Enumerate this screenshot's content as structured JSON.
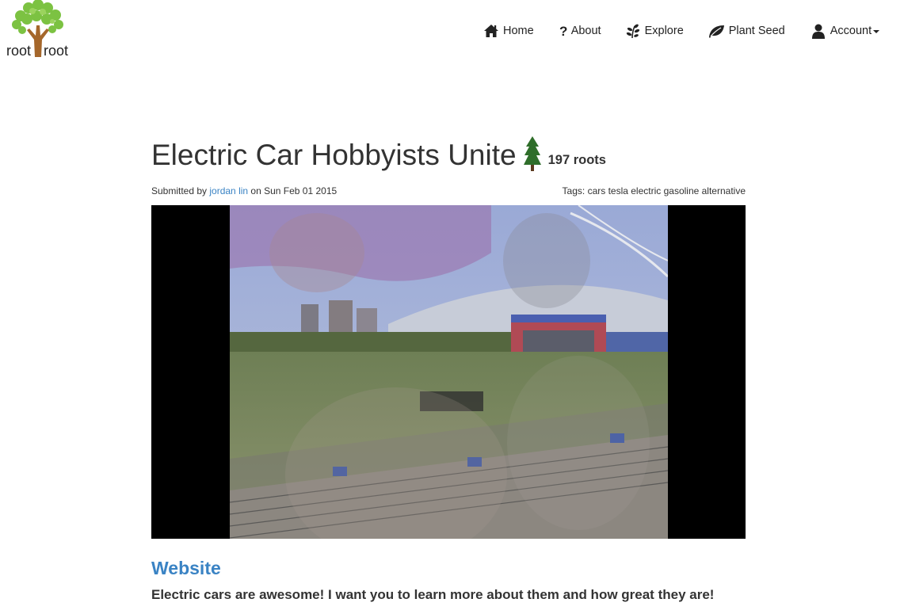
{
  "logo": {
    "word_left": "root",
    "word_right": "root"
  },
  "nav": {
    "items": [
      {
        "label": "Home",
        "icon": "home-icon"
      },
      {
        "label": "About",
        "icon": "question-icon"
      },
      {
        "label": "Explore",
        "icon": "sprout-icon"
      },
      {
        "label": "Plant Seed",
        "icon": "leaf-icon"
      },
      {
        "label": "Account",
        "icon": "user-icon"
      }
    ]
  },
  "post": {
    "title": "Electric Car Hobbyists Unite",
    "roots": "197 roots",
    "submitted_prefix": "Submitted by ",
    "author": "jordan lin",
    "date_text": " on Sun Feb 01 2015",
    "tags": "Tags: cars tesla electric gasoline alternative",
    "link_label": "Website",
    "description": "Electric cars are awesome! I want you to learn more about them and how great they are!"
  },
  "colors": {
    "link": "#3a83c4",
    "text": "#333333",
    "tree_green": "#2f6e2a",
    "leaf_green": "#7cc242",
    "trunk_brown": "#a5672b"
  }
}
